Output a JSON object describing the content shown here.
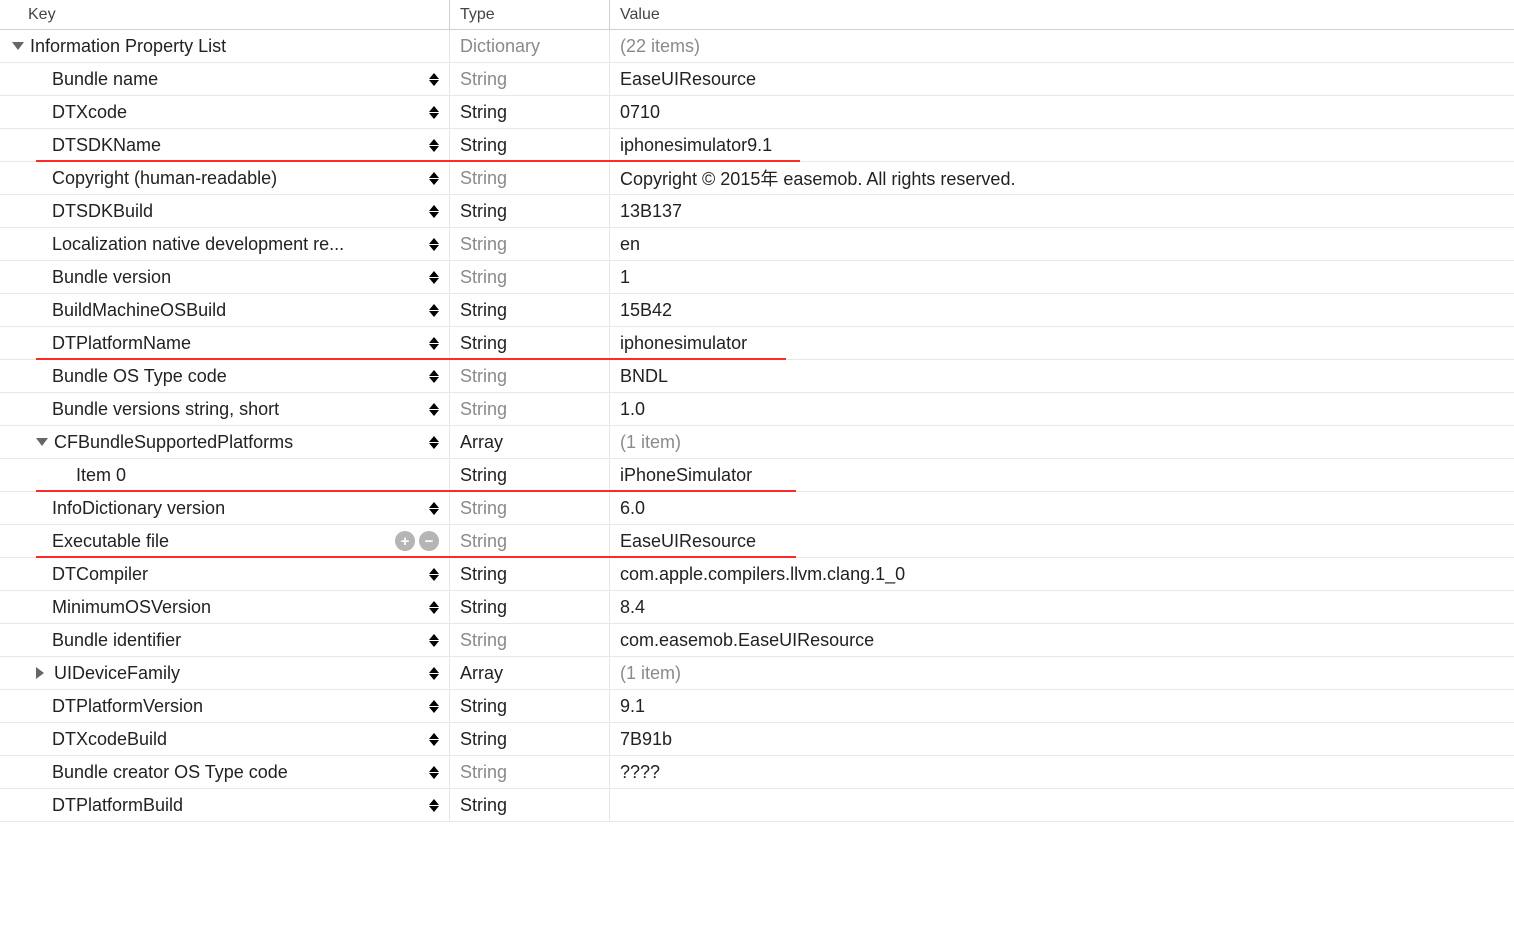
{
  "header": {
    "key": "Key",
    "type": "Type",
    "value": "Value"
  },
  "root": {
    "label": "Information Property List",
    "type": "Dictionary",
    "summary": "(22 items)"
  },
  "rows": [
    {
      "key": "Bundle name",
      "type": "String",
      "typeGray": true,
      "value": "EaseUIResource",
      "stepper": true
    },
    {
      "key": "DTXcode",
      "type": "String",
      "typeGray": false,
      "value": "0710",
      "stepper": true
    },
    {
      "key": "DTSDKName",
      "type": "String",
      "typeGray": false,
      "value": "iphonesimulator9.1",
      "stepper": true,
      "redUnder": {
        "keyLeft": 36,
        "keyWidth": 414,
        "valWidth": 190
      }
    },
    {
      "key": "Copyright (human-readable)",
      "type": "String",
      "typeGray": true,
      "value": "Copyright © 2015年 easemob. All rights reserved.",
      "stepper": true
    },
    {
      "key": "DTSDKBuild",
      "type": "String",
      "typeGray": false,
      "value": "13B137",
      "stepper": true
    },
    {
      "key": "Localization native development re...",
      "type": "String",
      "typeGray": true,
      "value": "en",
      "stepper": true,
      "valueStepper": true
    },
    {
      "key": "Bundle version",
      "type": "String",
      "typeGray": true,
      "value": "1",
      "stepper": true
    },
    {
      "key": "BuildMachineOSBuild",
      "type": "String",
      "typeGray": false,
      "value": "15B42",
      "stepper": true
    },
    {
      "key": "DTPlatformName",
      "type": "String",
      "typeGray": false,
      "value": "iphonesimulator",
      "stepper": true,
      "redUnder": {
        "keyLeft": 36,
        "keyWidth": 414,
        "valWidth": 176
      }
    },
    {
      "key": "Bundle OS Type code",
      "type": "String",
      "typeGray": true,
      "value": "BNDL",
      "stepper": true
    },
    {
      "key": "Bundle versions string, short",
      "type": "String",
      "typeGray": true,
      "value": "1.0",
      "stepper": true
    },
    {
      "key": "CFBundleSupportedPlatforms",
      "type": "Array",
      "typeGray": false,
      "value": "(1 item)",
      "valueGray": true,
      "stepper": true,
      "disclosure": "open",
      "indent": 1
    },
    {
      "key": "Item 0",
      "type": "String",
      "typeGray": false,
      "value": "iPhoneSimulator",
      "indent": 2,
      "redUnder": {
        "keyLeft": 36,
        "keyWidth": 414,
        "valWidth": 186
      }
    },
    {
      "key": "InfoDictionary version",
      "type": "String",
      "typeGray": true,
      "value": "6.0",
      "stepper": true
    },
    {
      "key": "Executable file",
      "type": "String",
      "typeGray": true,
      "value": "EaseUIResource",
      "plusMinus": true,
      "redUnder": {
        "keyLeft": 36,
        "keyWidth": 414,
        "valWidth": 186
      }
    },
    {
      "key": "DTCompiler",
      "type": "String",
      "typeGray": false,
      "value": "com.apple.compilers.llvm.clang.1_0",
      "stepper": true
    },
    {
      "key": "MinimumOSVersion",
      "type": "String",
      "typeGray": false,
      "value": "8.4",
      "stepper": true
    },
    {
      "key": "Bundle identifier",
      "type": "String",
      "typeGray": true,
      "value": "com.easemob.EaseUIResource",
      "stepper": true
    },
    {
      "key": "UIDeviceFamily",
      "type": "Array",
      "typeGray": false,
      "value": "(1 item)",
      "valueGray": true,
      "stepper": true,
      "disclosure": "closed",
      "indent": 1
    },
    {
      "key": "DTPlatformVersion",
      "type": "String",
      "typeGray": false,
      "value": "9.1",
      "stepper": true
    },
    {
      "key": "DTXcodeBuild",
      "type": "String",
      "typeGray": false,
      "value": "7B91b",
      "stepper": true
    },
    {
      "key": "Bundle creator OS Type code",
      "type": "String",
      "typeGray": true,
      "value": "????",
      "stepper": true
    },
    {
      "key": "DTPlatformBuild",
      "type": "String",
      "typeGray": false,
      "value": "",
      "stepper": true
    }
  ]
}
